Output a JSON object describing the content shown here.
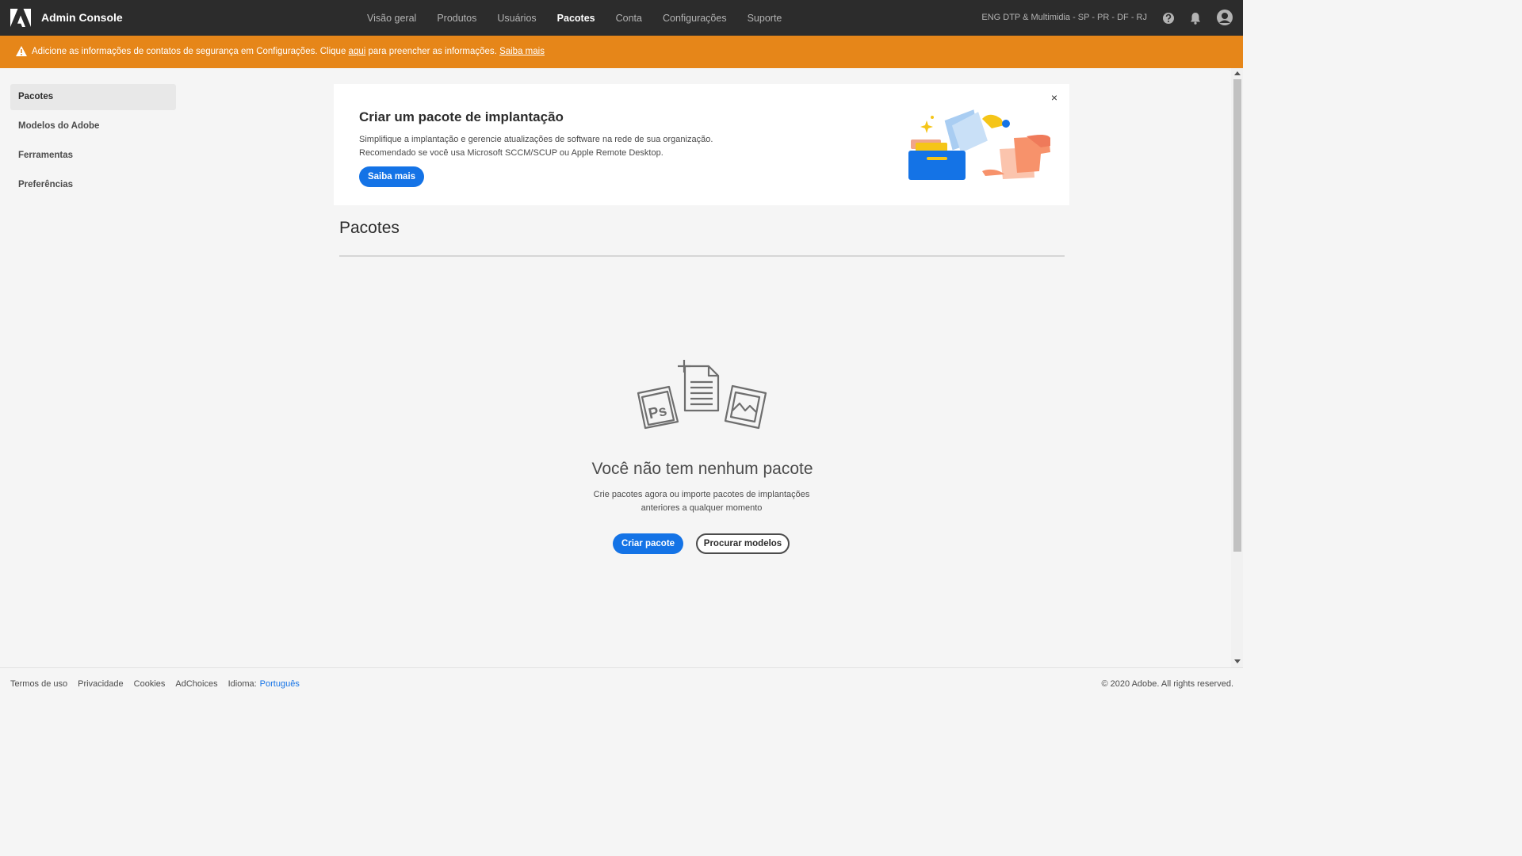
{
  "header": {
    "app_title": "Admin Console",
    "nav": [
      {
        "label": "Visão geral",
        "active": false
      },
      {
        "label": "Produtos",
        "active": false
      },
      {
        "label": "Usuários",
        "active": false
      },
      {
        "label": "Pacotes",
        "active": true
      },
      {
        "label": "Conta",
        "active": false
      },
      {
        "label": "Configurações",
        "active": false
      },
      {
        "label": "Suporte",
        "active": false
      }
    ],
    "org_name": "ENG DTP & Multimidia - SP - PR - DF - RJ",
    "icons": [
      "help-icon",
      "bell-icon",
      "user-avatar-icon"
    ]
  },
  "alert": {
    "text_before": "Adicione as informações de contatos de segurança em Configurações. Clique ",
    "link_here": "aqui",
    "text_after": " para preencher as informações. ",
    "link_learn": "Saiba mais",
    "color": "#e68619"
  },
  "sidebar": {
    "items": [
      {
        "label": "Pacotes",
        "active": true
      },
      {
        "label": "Modelos do Adobe",
        "active": false
      },
      {
        "label": "Ferramentas",
        "active": false
      },
      {
        "label": "Preferências",
        "active": false
      }
    ]
  },
  "banner": {
    "title": "Criar um pacote de implantação",
    "line1": "Simplifique a implantação e gerencie atualizações de software na rede de sua organização.",
    "line2": "Recomendado se você usa Microsoft SCCM/SCUP ou Apple Remote Desktop.",
    "button": "Saiba mais",
    "close": "×"
  },
  "main": {
    "page_title": "Pacotes",
    "empty_title": "Você não tem nenhum pacote",
    "empty_desc_line1": "Crie pacotes agora ou importe pacotes de implantações",
    "empty_desc_line2": "anteriores a qualquer momento",
    "create_button": "Criar pacote",
    "browse_button": "Procurar modelos",
    "illustration_label": "Ps"
  },
  "footer": {
    "links": [
      "Termos de uso",
      "Privacidade",
      "Cookies",
      "AdChoices"
    ],
    "language_label": "Idioma:",
    "language_value": "Português",
    "copyright": "© 2020 Adobe. All rights reserved."
  },
  "colors": {
    "accent": "#1473e6",
    "topbar": "#2c2c2c",
    "warning": "#e68619"
  }
}
